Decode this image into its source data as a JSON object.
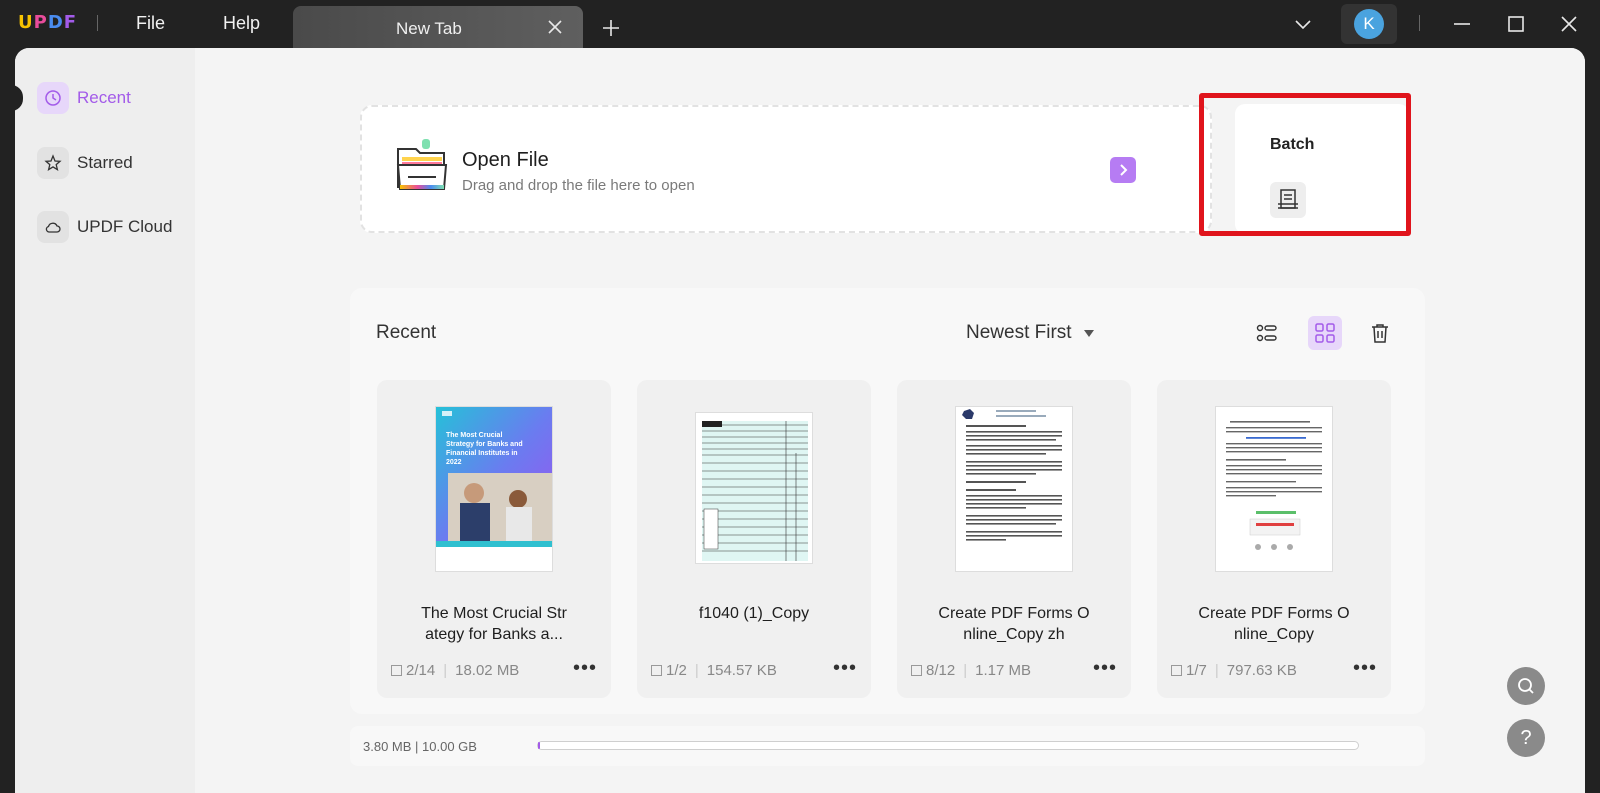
{
  "app": {
    "logo_letters": [
      "U",
      "P",
      "D",
      "F"
    ],
    "logo_colors": [
      "#f7c300",
      "#e84c9b",
      "#4a8cf0",
      "#a35be9"
    ],
    "menu": {
      "file": "File",
      "help": "Help"
    },
    "tab_label": "New Tab",
    "avatar_letter": "K"
  },
  "sidebar": {
    "items": [
      {
        "label": "Recent",
        "icon": "clock-icon",
        "active": true
      },
      {
        "label": "Starred",
        "icon": "star-icon",
        "active": false
      },
      {
        "label": "UPDF Cloud",
        "icon": "cloud-icon",
        "active": false
      }
    ]
  },
  "open_file": {
    "title": "Open File",
    "subtitle": "Drag and drop the file here to open"
  },
  "batch": {
    "title": "Batch"
  },
  "recent": {
    "title": "Recent",
    "sort_label": "Newest First",
    "files": [
      {
        "name": "The Most Crucial Str\nategy for Banks a...",
        "pages": "2/14",
        "size": "18.02 MB",
        "thumb_title": "The Most Crucial Strategy for Banks and Financial Institutes in 2022"
      },
      {
        "name": "f1040 (1)_Copy",
        "pages": "1/2",
        "size": "154.57 KB"
      },
      {
        "name": "Create PDF Forms O\nnline_Copy zh",
        "pages": "8/12",
        "size": "1.17 MB"
      },
      {
        "name": "Create PDF Forms O\nnline_Copy",
        "pages": "1/7",
        "size": "797.63 KB"
      }
    ]
  },
  "storage": {
    "label": "3.80 MB | 10.00 GB",
    "used_fraction": 0.0004
  },
  "float": {
    "help": "?"
  },
  "colors": {
    "accent": "#a35be9",
    "highlight": "#e0141c"
  }
}
